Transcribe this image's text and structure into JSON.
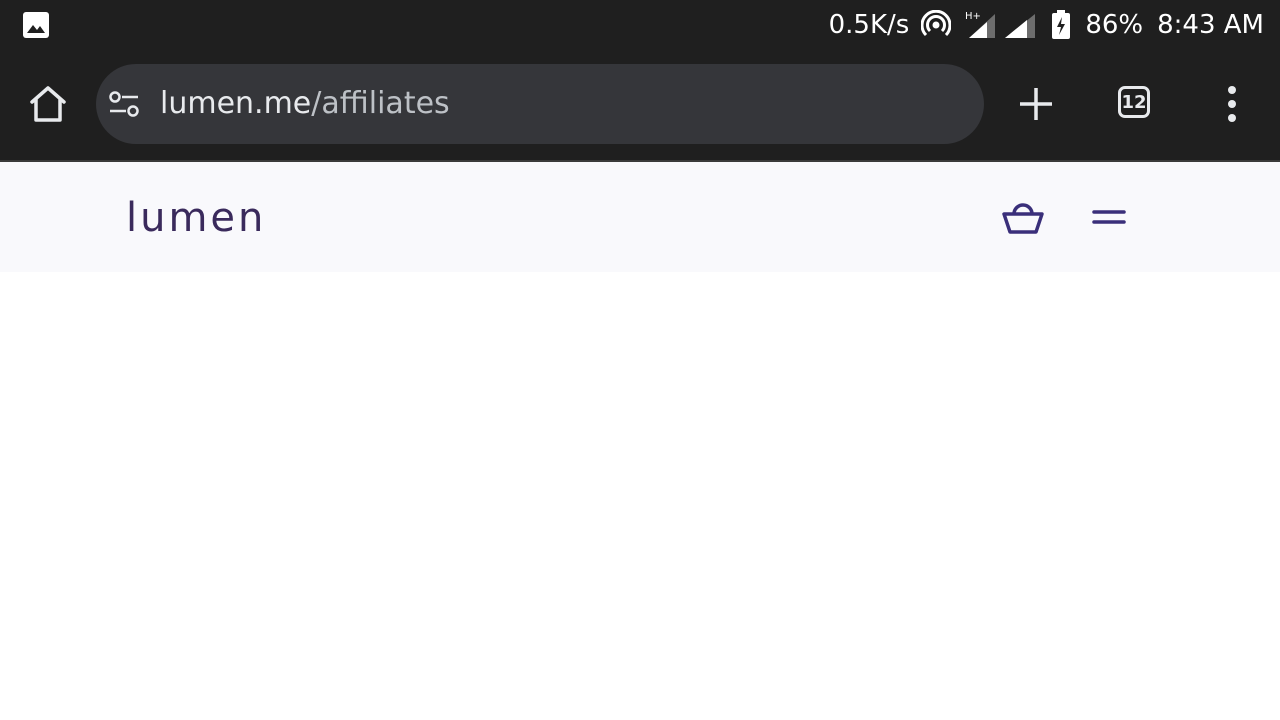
{
  "status_bar": {
    "net_speed": "0.5K/s",
    "network_type": "H+",
    "battery_percent": "86%",
    "time": "8:43 AM"
  },
  "browser": {
    "url_domain": "lumen.me",
    "url_path": "/affiliates",
    "tab_count": "12"
  },
  "site": {
    "logo_text": "lumen"
  },
  "colors": {
    "status_bg": "#1f1f1f",
    "url_bar_bg": "#35363a",
    "site_header_bg": "#f9f9fc",
    "brand_purple": "#3a2a5c"
  }
}
